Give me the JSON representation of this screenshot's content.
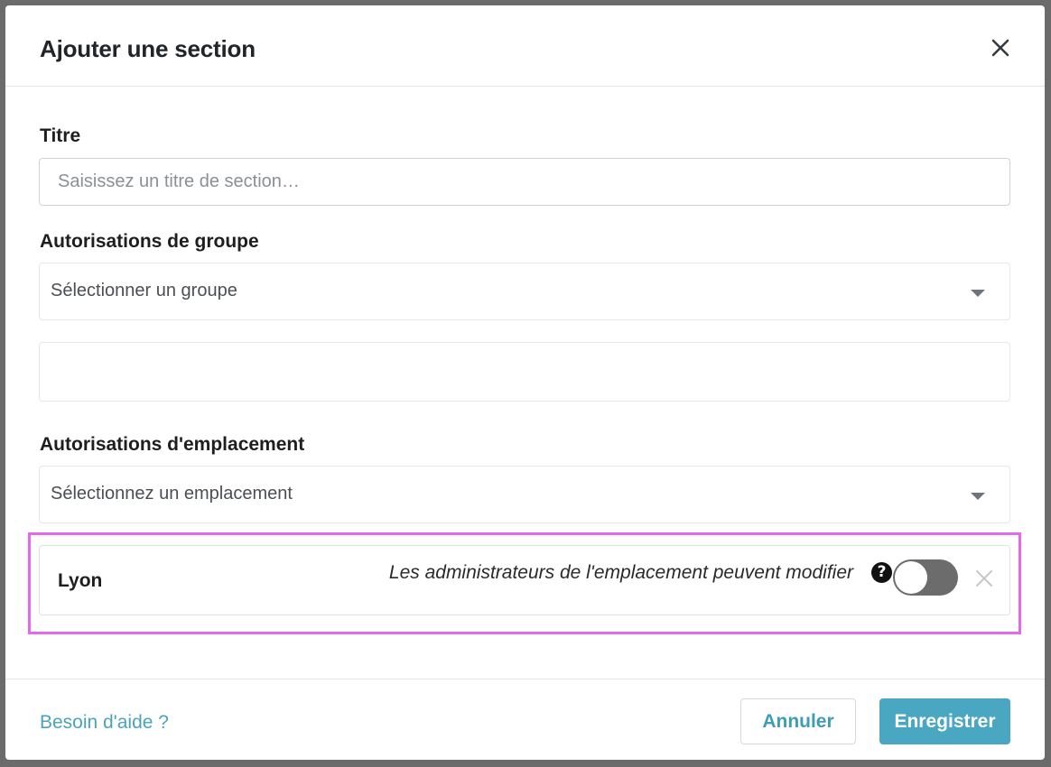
{
  "modal": {
    "title": "Ajouter une section"
  },
  "title_field": {
    "label": "Titre",
    "placeholder": "Saisissez un titre de section…",
    "value": ""
  },
  "group_permissions": {
    "label": "Autorisations de groupe",
    "select_value": "Sélectionner un groupe"
  },
  "location_permissions": {
    "label": "Autorisations d'emplacement",
    "select_value": "Sélectionnez un emplacement",
    "items": [
      {
        "name": "Lyon",
        "permission_text": "Les administrateurs de l'emplacement peuvent modifier",
        "help_glyph": "?",
        "toggle_on": false
      }
    ]
  },
  "footer": {
    "help_link": "Besoin d'aide ?",
    "cancel_label": "Annuler",
    "save_label": "Enregistrer"
  },
  "colors": {
    "accent": "#4aa7c1",
    "highlight": "#e766ef",
    "toggle_off": "#6c6c6c"
  },
  "icons": {
    "close": "close-icon",
    "caret": "chevron-down-icon",
    "help": "help-circle-icon",
    "remove": "remove-icon"
  }
}
